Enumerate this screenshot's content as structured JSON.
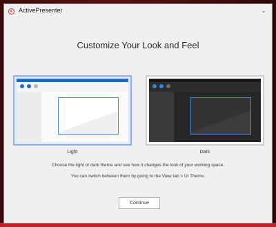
{
  "window": {
    "title": "ActivePresenter",
    "collapse_icon": "chevron-down"
  },
  "heading": "Customize Your Look and Feel",
  "themes": [
    {
      "label": "Light",
      "selected": true
    },
    {
      "label": "Dark",
      "selected": false
    }
  ],
  "description": {
    "line1": "Choose the light or dark theme and see how it changes the look of your working space.",
    "line2": "You can switch between them by going to the View tab > UI Theme."
  },
  "continue_label": "Continue",
  "colors": {
    "accent": "#1e6fc4",
    "selected_border": "#8db1ee",
    "app_red": "#d6262c"
  }
}
